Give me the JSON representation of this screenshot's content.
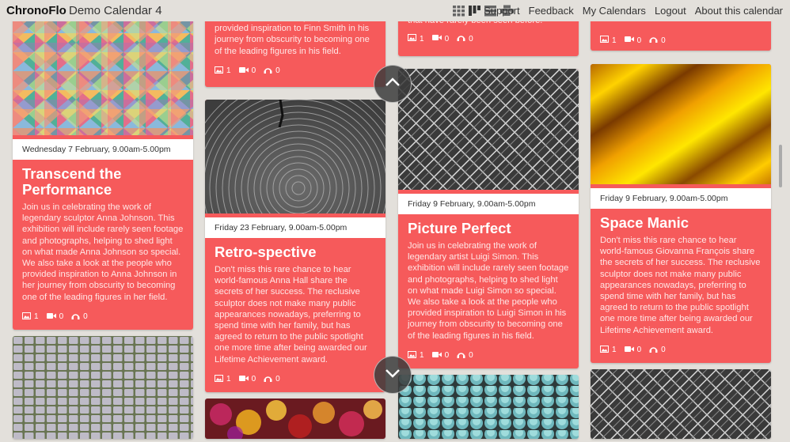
{
  "header": {
    "brand": "ChronoFlo",
    "calendar_name": "Demo Calendar 4",
    "view_icons": [
      "grid-view-icon",
      "masonry-view-icon",
      "list-view-icon",
      "print-icon"
    ],
    "nav": [
      "Support",
      "Feedback",
      "My Calendars",
      "Logout",
      "About this calendar"
    ]
  },
  "colors": {
    "card": "#f65a5b",
    "background": "#e3e0db"
  },
  "cards": [
    {
      "date": "Wednesday 7 February, 9.00am-5.00pm",
      "title": "Transcend the Performance",
      "description": "Join us in celebrating the work of legendary sculptor Anna Johnson. This exhibition will include rarely seen footage and photographs, helping to shed light on what made Anna Johnson so special. We also take a look at the people who provided inspiration to Anna Johnson in her journey from obscurity to becoming one of the leading figures in her field.",
      "images": "1",
      "videos": "0",
      "audio": "0"
    },
    {
      "description_tail": "also take a look at the people who provided inspiration to Finn Smith in his journey from obscurity to becoming one of the leading figures in his field.",
      "images": "1",
      "videos": "0",
      "audio": "0"
    },
    {
      "date": "Friday 23 February, 9.00am-5.00pm",
      "title": "Retro-spective",
      "description": "Don't miss this rare chance to hear world-famous Anna Hall share the secrets of her success. The reclusive sculptor does not make many public appearances nowadays, preferring to spend time with her family, but has agreed to return to the public spotlight one more time after being awarded our Lifetime Achievement award.",
      "images": "1",
      "videos": "0",
      "audio": "0"
    },
    {
      "description_tail": "that have rarely been seen before.",
      "images": "1",
      "videos": "0",
      "audio": "0"
    },
    {
      "date": "Friday 9 February, 9.00am-5.00pm",
      "title": "Picture Perfect",
      "description": "Join us in celebrating the work of legendary artist Luigi Simon. This exhibition will include rarely seen footage and photographs, helping to shed light on what made Luigi Simon so special. We also take a look at the people who provided inspiration to Luigi Simon in his journey from obscurity to becoming one of the leading figures in his field.",
      "images": "1",
      "videos": "0",
      "audio": "0"
    },
    {
      "images": "1",
      "videos": "0",
      "audio": "0"
    },
    {
      "date": "Friday 9 February, 9.00am-5.00pm",
      "title": "Space Manic",
      "description": "Don't miss this rare chance to hear world-famous Giovanna François share the secrets of her success. The reclusive sculptor does not make many public appearances nowadays, preferring to spend time with her family, but has agreed to return to the public spotlight one more time after being awarded our Lifetime Achievement award.",
      "images": "1",
      "videos": "0",
      "audio": "0"
    }
  ],
  "scroll": {
    "up": "chevron-up-icon",
    "down": "chevron-down-icon"
  }
}
